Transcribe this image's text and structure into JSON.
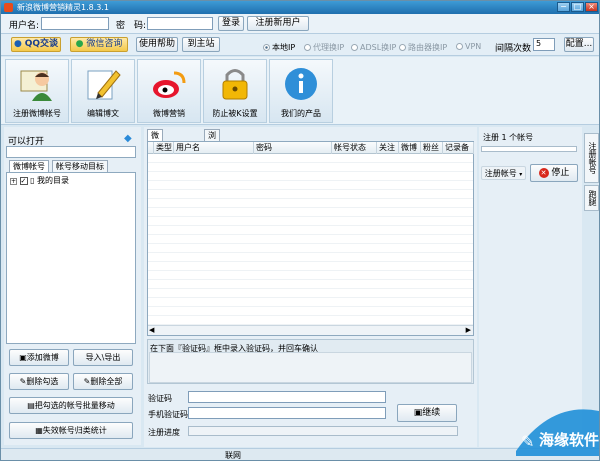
{
  "window": {
    "title": "新浪微博营销精灵1.8.3.1",
    "minimize": "−",
    "maximize": "□",
    "close": "×"
  },
  "login": {
    "username_label": "用户名:",
    "username_value": "",
    "password_label": "密　码:",
    "password_value": "",
    "login_button": "登录",
    "register_button": "注册新用户"
  },
  "toolbar": {
    "qq_button": "QQ交谈",
    "wechat_button": "微信咨询",
    "help_button": "使用帮助",
    "site_button": "到主站",
    "radios": [
      {
        "label": "本地IP",
        "selected": true
      },
      {
        "label": "代理换IP",
        "selected": false
      },
      {
        "label": "ADSL换IP",
        "selected": false
      },
      {
        "label": "路由器换IP",
        "selected": false
      },
      {
        "label": "VPN",
        "selected": false
      }
    ],
    "interval_label": "间隔次数",
    "interval_value": "5",
    "config_button": "配置..."
  },
  "iconbar": [
    {
      "label": "注册微博帐号",
      "icon": "user-reading-icon"
    },
    {
      "label": "编辑博文",
      "icon": "pencil-icon"
    },
    {
      "label": "微博营销",
      "icon": "weibo-icon"
    },
    {
      "label": "防止被K设置",
      "icon": "lock-icon"
    },
    {
      "label": "我们的产品",
      "icon": "info-icon"
    }
  ],
  "left": {
    "can_open_label": "可以打开",
    "tabs": [
      "微博帐号",
      "帐号移动目标"
    ],
    "tree_root": "我的目录",
    "buttons": {
      "add": "添加微博",
      "import_export": "导入\\导出",
      "delete_checked": "删除勾选",
      "delete_all": "删除全部",
      "batch_move": "把勾选的帐号批量移动",
      "invalid_stats": "失效帐号归类统计"
    }
  },
  "center": {
    "tabs": [
      "微博帐号列表",
      "浏览器操作"
    ],
    "columns": [
      "类型",
      "用户名",
      "密码",
      "帐号状态",
      "关注",
      "微博",
      "粉丝",
      "记录备"
    ],
    "captcha_hint": "在下面『验证码』框中录入验证码，并回车确认",
    "captcha_label": "验证码",
    "phone_captcha_label": "手机验证码",
    "progress_label": "注册进度",
    "continue_button": "继续"
  },
  "right": {
    "registered_label": "注册 1 个帐号",
    "register_account_button": "注册帐号",
    "stop_button": "停止"
  },
  "vtabs": [
    "注册帐号",
    "跑腿"
  ],
  "status": {
    "network": "联网"
  },
  "watermark": {
    "text": "海缘软件"
  }
}
